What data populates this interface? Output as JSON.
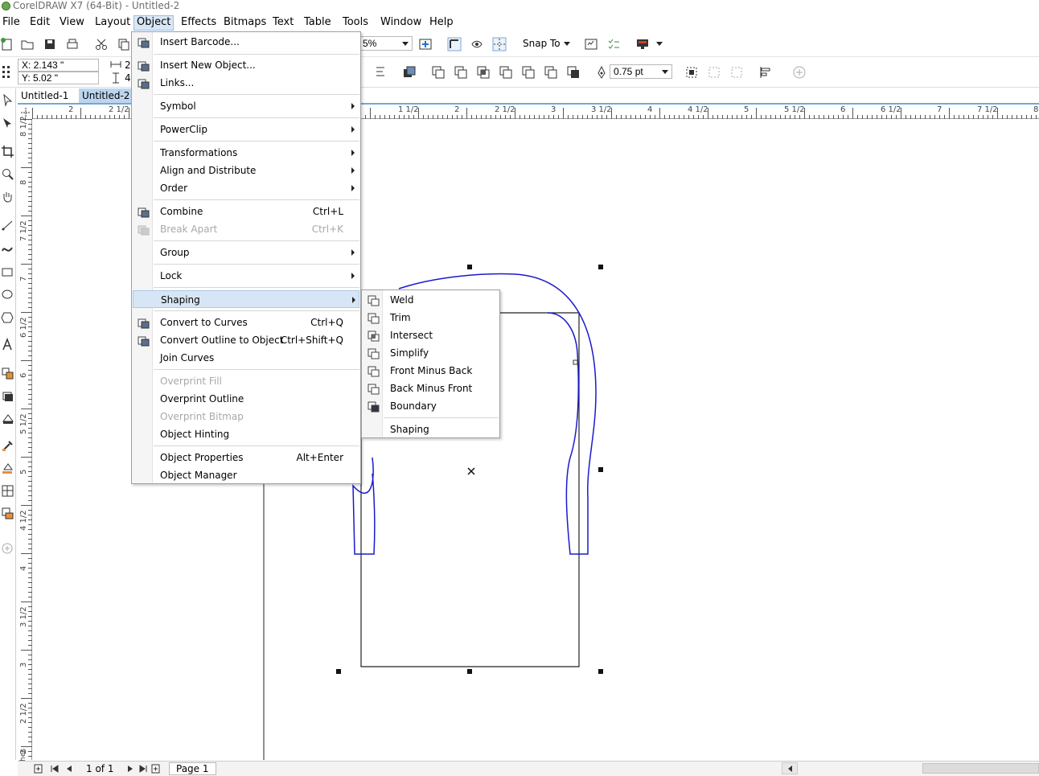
{
  "title": "CorelDRAW X7 (64-Bit) - Untitled-2",
  "menubar": [
    "File",
    "Edit",
    "View",
    "Layout",
    "Object",
    "Effects",
    "Bitmaps",
    "Text",
    "Table",
    "Tools",
    "Window",
    "Help"
  ],
  "toolbar": {
    "zoom_value": "5%",
    "snap_to": "Snap To",
    "outline_width": "0.75 pt"
  },
  "property_bar": {
    "x_value": "X: 2.143 \"",
    "y_value": "Y: 5.02 \"",
    "w_partial": "2",
    "h_partial": "4"
  },
  "doc_tabs": [
    "Untitled-1",
    "Untitled-2"
  ],
  "ruler_h": [
    "2",
    "2 1/2",
    "1 1/2",
    "2",
    "2 1/2",
    "3",
    "3 1/2",
    "4",
    "4 1/2",
    "5",
    "5 1/2",
    "6",
    "6 1/2",
    "7",
    "7 1/2",
    "8"
  ],
  "ruler_v": [
    "8 1/2",
    "8",
    "7 1/2",
    "7",
    "6 1/2",
    "6",
    "5 1/2",
    "5",
    "4 1/2",
    "4",
    "3 1/2",
    "3",
    "2 1/2",
    "2"
  ],
  "ruler_unit": "inches",
  "object_menu": {
    "items": [
      {
        "label": "Insert Barcode...",
        "shortcut": "",
        "submenu": false,
        "disabled": false
      },
      {
        "label": "Insert New Object...",
        "shortcut": "",
        "submenu": false,
        "disabled": false
      },
      {
        "label": "Links...",
        "shortcut": "",
        "submenu": false,
        "disabled": false
      },
      {
        "label": "Symbol",
        "shortcut": "",
        "submenu": true,
        "disabled": false
      },
      {
        "label": "PowerClip",
        "shortcut": "",
        "submenu": true,
        "disabled": false
      },
      {
        "label": "Transformations",
        "shortcut": "",
        "submenu": true,
        "disabled": false
      },
      {
        "label": "Align and Distribute",
        "shortcut": "",
        "submenu": true,
        "disabled": false
      },
      {
        "label": "Order",
        "shortcut": "",
        "submenu": true,
        "disabled": false
      },
      {
        "label": "Combine",
        "shortcut": "Ctrl+L",
        "submenu": false,
        "disabled": false
      },
      {
        "label": "Break Apart",
        "shortcut": "Ctrl+K",
        "submenu": false,
        "disabled": true
      },
      {
        "label": "Group",
        "shortcut": "",
        "submenu": true,
        "disabled": false
      },
      {
        "label": "Lock",
        "shortcut": "",
        "submenu": true,
        "disabled": false
      },
      {
        "label": "Shaping",
        "shortcut": "",
        "submenu": true,
        "disabled": false
      },
      {
        "label": "Convert to Curves",
        "shortcut": "Ctrl+Q",
        "submenu": false,
        "disabled": false
      },
      {
        "label": "Convert Outline to Object",
        "shortcut": "Ctrl+Shift+Q",
        "submenu": false,
        "disabled": false
      },
      {
        "label": "Join Curves",
        "shortcut": "",
        "submenu": false,
        "disabled": false
      },
      {
        "label": "Overprint Fill",
        "shortcut": "",
        "submenu": false,
        "disabled": true
      },
      {
        "label": "Overprint Outline",
        "shortcut": "",
        "submenu": false,
        "disabled": false
      },
      {
        "label": "Overprint Bitmap",
        "shortcut": "",
        "submenu": false,
        "disabled": true
      },
      {
        "label": "Object Hinting",
        "shortcut": "",
        "submenu": false,
        "disabled": false
      },
      {
        "label": "Object Properties",
        "shortcut": "Alt+Enter",
        "submenu": false,
        "disabled": false
      },
      {
        "label": "Object Manager",
        "shortcut": "",
        "submenu": false,
        "disabled": false
      }
    ]
  },
  "shaping_menu": {
    "items": [
      "Weld",
      "Trim",
      "Intersect",
      "Simplify",
      "Front Minus Back",
      "Back Minus Front",
      "Boundary",
      "Shaping"
    ]
  },
  "status_bar": {
    "page_count": "1 of 1",
    "page_tab": "Page 1"
  },
  "colors": {
    "menu_highlight": "#d7e6f5",
    "tab_active": "#bcd5ee",
    "selected_curve": "#1a1acc"
  }
}
